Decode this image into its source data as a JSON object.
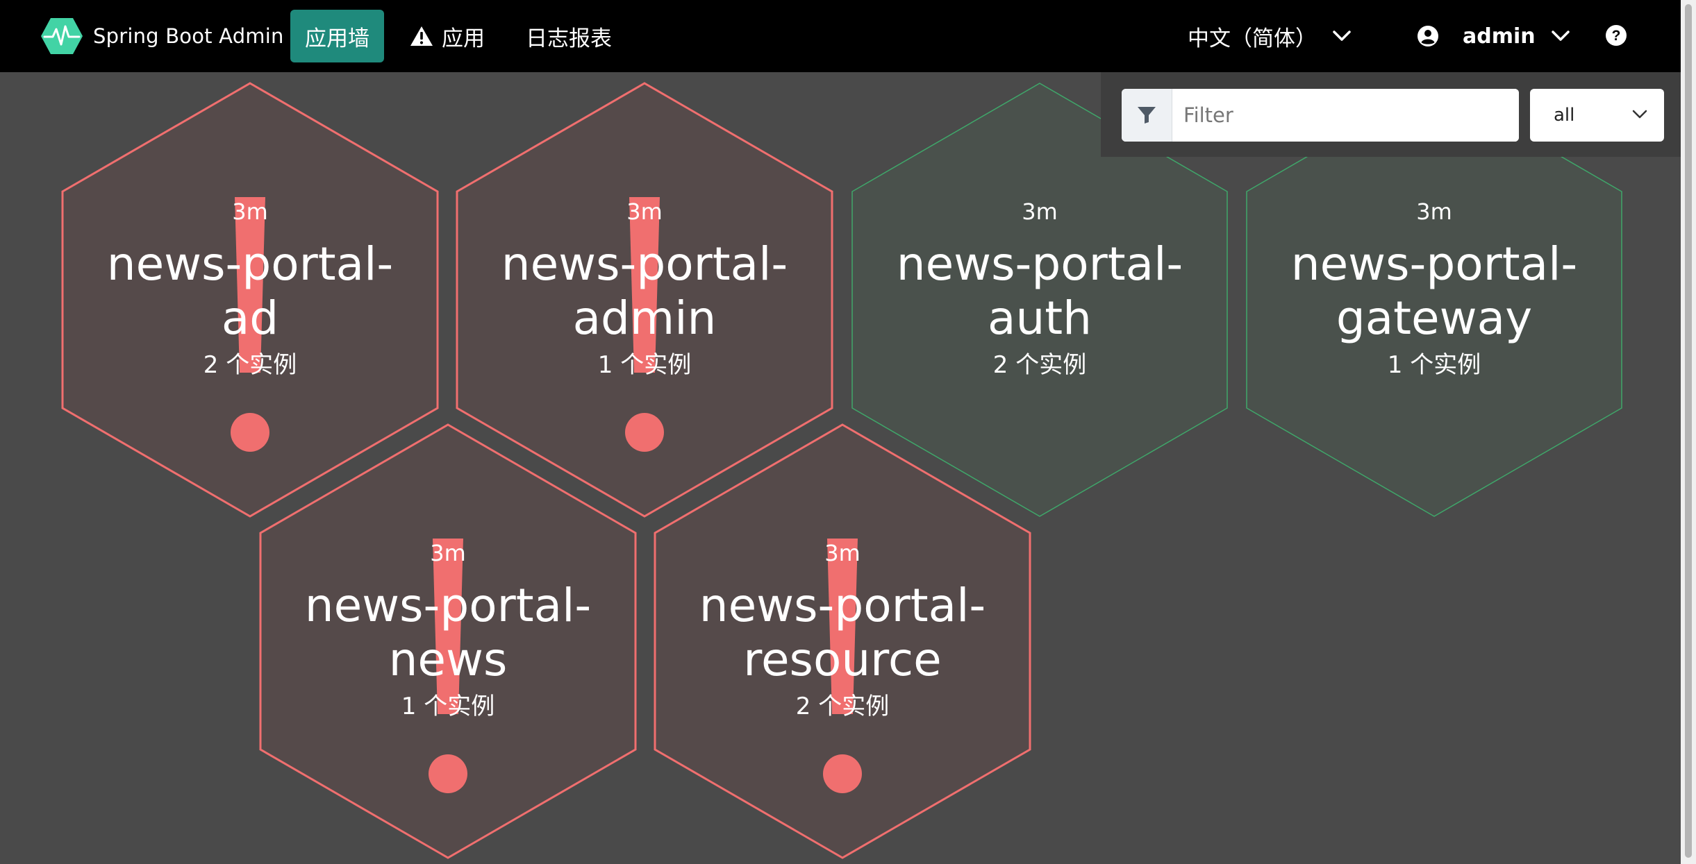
{
  "navbar": {
    "brand": "Spring Boot Admin",
    "items": [
      {
        "label": "应用墙",
        "active": true
      },
      {
        "label": "应用",
        "icon": "warning-icon"
      },
      {
        "label": "日志报表"
      }
    ],
    "language": "中文（简体）",
    "user": "admin",
    "help_icon": "question-circle-icon"
  },
  "filter": {
    "placeholder": "Filter",
    "value": "",
    "select_value": "all"
  },
  "colors": {
    "down": "#f06f6f",
    "up": "#3fa76a",
    "accent": "#1f8a7c",
    "background": "#4a4a4a"
  },
  "applications": [
    {
      "name_line1": "news-portal-",
      "name_line2": "ad",
      "time": "3m",
      "instances": "2 个实例",
      "status": "down"
    },
    {
      "name_line1": "news-portal-",
      "name_line2": "admin",
      "time": "3m",
      "instances": "1 个实例",
      "status": "down"
    },
    {
      "name_line1": "news-portal-",
      "name_line2": "auth",
      "time": "3m",
      "instances": "2 个实例",
      "status": "up"
    },
    {
      "name_line1": "news-portal-",
      "name_line2": "gateway",
      "time": "3m",
      "instances": "1 个实例",
      "status": "up"
    },
    {
      "name_line1": "news-portal-",
      "name_line2": "news",
      "time": "3m",
      "instances": "1 个实例",
      "status": "down"
    },
    {
      "name_line1": "news-portal-",
      "name_line2": "resource",
      "time": "3m",
      "instances": "2 个实例",
      "status": "down"
    }
  ]
}
